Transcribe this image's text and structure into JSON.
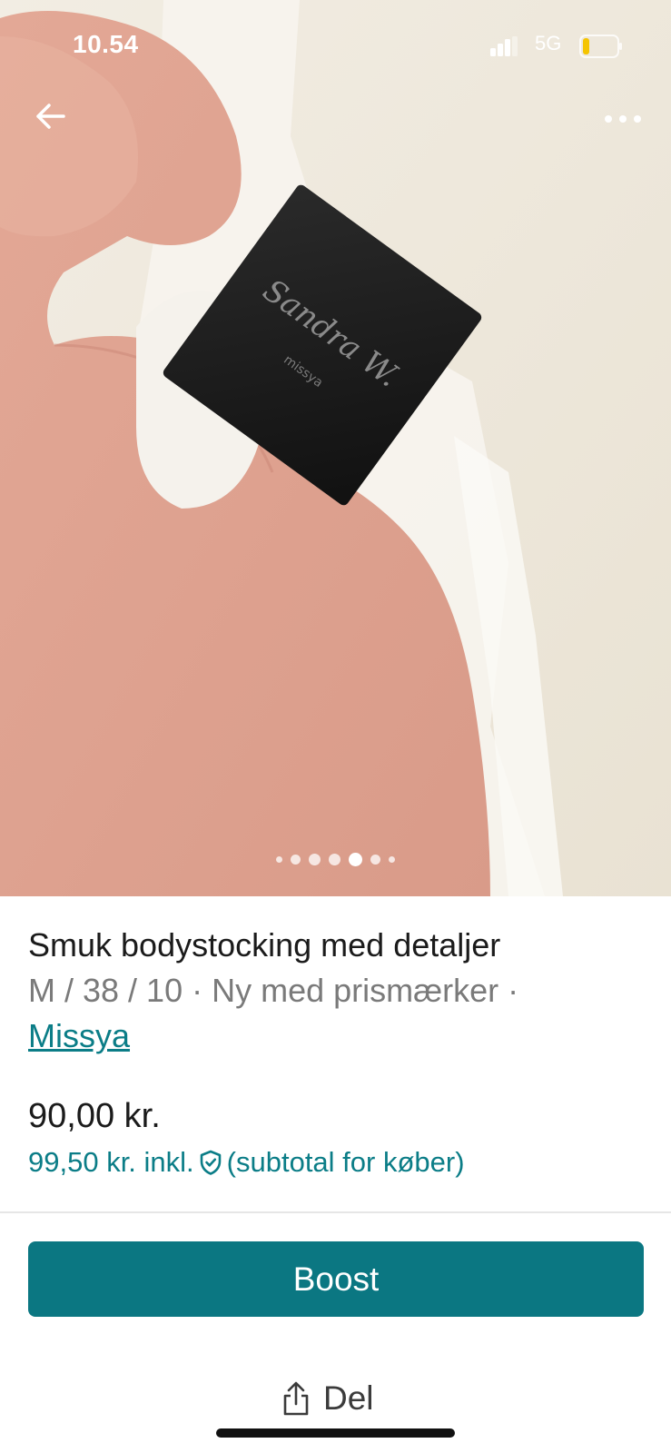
{
  "status_bar": {
    "time": "10.54",
    "network": "5G",
    "battery_level": 0.15,
    "battery_color": "#f5c400"
  },
  "header": {
    "back_icon": "arrow-left-icon",
    "more_icon": "more-horizontal-icon"
  },
  "gallery": {
    "photo_description_icon": "product-photo",
    "total_images": 7,
    "active_index": 4
  },
  "product": {
    "title": "Smuk bodystocking med detaljer",
    "meta": "M / 38 / 10 · Ny med prismærker ·",
    "brand": "Missya",
    "price": "90,00 kr.",
    "price_incl": "99,50 kr. inkl.",
    "price_incl_suffix": "(subtotal for køber)"
  },
  "actions": {
    "boost_label": "Boost",
    "share_label": "Del",
    "share_icon": "share-icon"
  },
  "colors": {
    "accent": "#0b7782",
    "link": "#0b7d87",
    "text_primary": "#1b1b1b",
    "text_secondary": "#7a7a7a"
  }
}
